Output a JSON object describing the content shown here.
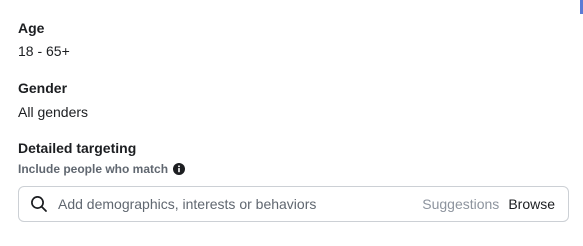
{
  "age": {
    "label": "Age",
    "value": "18 - 65+"
  },
  "gender": {
    "label": "Gender",
    "value": "All genders"
  },
  "detailed_targeting": {
    "label": "Detailed targeting",
    "include_label": "Include people who match",
    "info_icon": "info-circle-icon",
    "search": {
      "icon": "search-icon",
      "placeholder": "Add demographics, interests or behaviors",
      "value": ""
    },
    "suggestions_label": "Suggestions",
    "browse_label": "Browse"
  },
  "colors": {
    "text_primary": "#1c1e21",
    "text_secondary": "#606770",
    "text_muted": "#8d949e",
    "border": "#ccd0d5"
  }
}
